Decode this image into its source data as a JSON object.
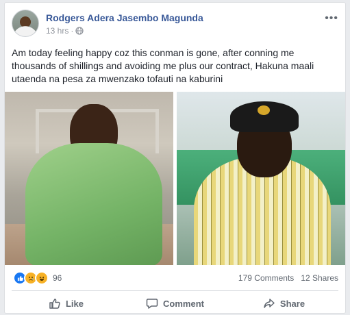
{
  "post": {
    "author": "Rodgers Adera Jasembo Magunda",
    "time": "13 hrs",
    "privacy_icon": "globe-icon",
    "more_icon": "ellipsis-icon",
    "text": "Am today feeling happy coz this conman is gone, after conning me thousands of shillings and avoiding me plus our contract, Hakuna maali utaenda na pesa za mwenzako tofauti na kaburini"
  },
  "reactions": {
    "icons": [
      "like-icon",
      "sad-icon",
      "haha-icon"
    ],
    "count": "96",
    "comments": "179 Comments",
    "shares": "12 Shares"
  },
  "actions": {
    "like": "Like",
    "comment": "Comment",
    "share": "Share"
  },
  "colors": {
    "author": "#385898",
    "like_blue": "#1877f2",
    "reaction_yellow": "#f7b125",
    "muted": "#606770"
  }
}
